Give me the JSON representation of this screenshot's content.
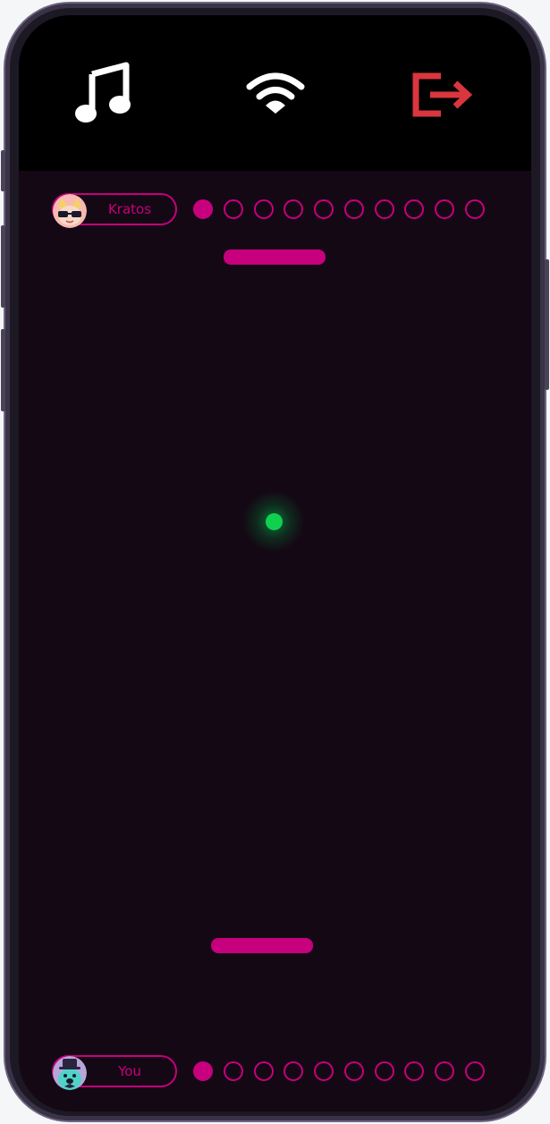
{
  "topbar": {
    "music_icon": "music-note-icon",
    "wifi_icon": "wifi-icon",
    "exit_icon": "exit-icon",
    "exit_color": "#d9363e"
  },
  "opponent": {
    "name": "Kratos",
    "avatar": "cool-cat-sunglasses-avatar",
    "score_points": [
      true,
      false,
      false,
      false,
      false,
      false,
      false,
      false,
      false,
      false
    ]
  },
  "player": {
    "name": "You",
    "avatar": "top-hat-dog-avatar",
    "score_points": [
      true,
      false,
      false,
      false,
      false,
      false,
      false,
      false,
      false,
      false
    ]
  },
  "colors": {
    "accent": "#c7007d",
    "ball": "#0fd14f",
    "court": "#140814",
    "header": "#000000"
  }
}
